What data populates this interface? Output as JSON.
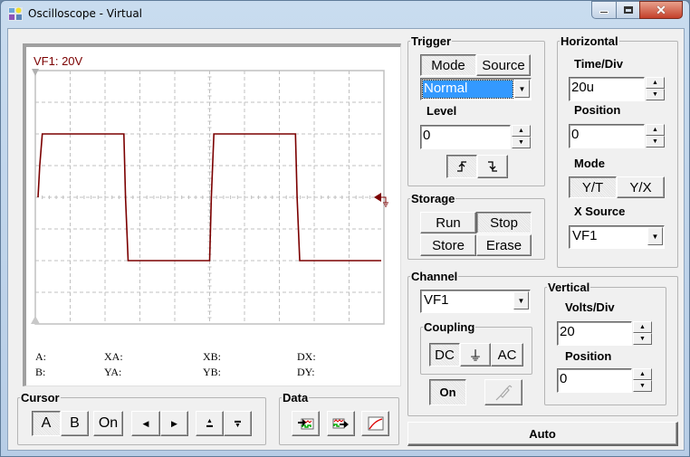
{
  "window": {
    "title": "Oscilloscope - Virtual",
    "controls": {
      "minimize": "minimize",
      "maximize": "maximize",
      "close": "close"
    }
  },
  "scope": {
    "channel_label": "VF1: 20V",
    "trace_color": "#7b0000",
    "grid": {
      "h_divisions": 10,
      "v_divisions": 8
    },
    "readouts": {
      "a": "A:",
      "b": "B:",
      "xa": "XA:",
      "ya": "YA:",
      "xb": "XB:",
      "yb": "YB:",
      "dx": "DX:",
      "dy": "DY:"
    }
  },
  "chart_data": {
    "type": "line",
    "title": "VF1: 20V",
    "xlabel": "",
    "ylabel": "",
    "x_divisions": 10,
    "y_divisions": 8,
    "time_per_div": "20u",
    "volts_per_div": 20,
    "ylim": [
      -80,
      80
    ],
    "xlim": [
      0,
      200
    ],
    "series": [
      {
        "name": "VF1",
        "x": [
          0,
          1,
          2.5,
          50,
          51,
          52.5,
          100,
          101,
          102.5,
          150,
          151,
          152.5,
          200
        ],
        "y": [
          0,
          20,
          40,
          40,
          0,
          -40,
          -40,
          0,
          40,
          40,
          0,
          -40,
          -40
        ]
      }
    ],
    "trigger_marker_level": 0,
    "grid": true
  },
  "trigger": {
    "title": "Trigger",
    "tabs": [
      "Mode",
      "Source"
    ],
    "mode_value": "Normal",
    "level_label": "Level",
    "level_value": "0",
    "edge_rising": "rising-edge",
    "edge_falling": "falling-edge"
  },
  "horizontal": {
    "title": "Horizontal",
    "time_div_label": "Time/Div",
    "time_div_value": "20u",
    "position_label": "Position",
    "position_value": "0",
    "mode_label": "Mode",
    "modes": [
      "Y/T",
      "Y/X"
    ],
    "x_source_label": "X Source",
    "x_source_value": "VF1"
  },
  "storage": {
    "title": "Storage",
    "buttons": [
      "Run",
      "Stop",
      "Store",
      "Erase"
    ]
  },
  "channel": {
    "title": "Channel",
    "value": "VF1",
    "coupling_title": "Coupling",
    "coupling": [
      "DC",
      "⏚",
      "AC"
    ],
    "on_label": "On"
  },
  "vertical": {
    "title": "Vertical",
    "volts_div_label": "Volts/Div",
    "volts_div_value": "20",
    "position_label": "Position",
    "position_value": "0"
  },
  "cursor": {
    "title": "Cursor",
    "a": "A",
    "b": "B",
    "on": "On"
  },
  "data": {
    "title": "Data"
  },
  "auto_label": "Auto"
}
